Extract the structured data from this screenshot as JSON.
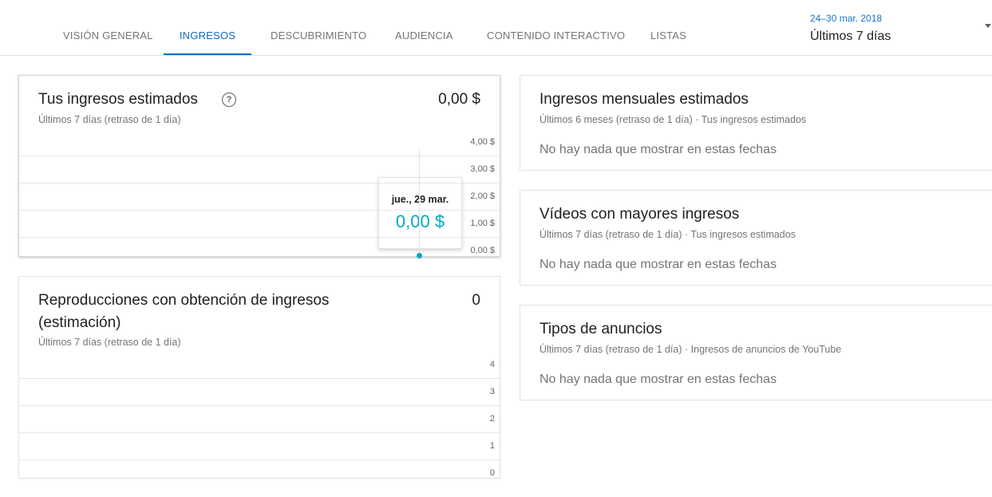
{
  "tabs": [
    {
      "label": "VISIÓN GENERAL",
      "active": false
    },
    {
      "label": "INGRESOS",
      "active": true
    },
    {
      "label": "DESCUBRIMIENTO",
      "active": false
    },
    {
      "label": "AUDIENCIA",
      "active": false
    },
    {
      "label": "CONTENIDO INTERACTIVO",
      "active": false
    },
    {
      "label": "LISTAS",
      "active": false
    }
  ],
  "date_selector": {
    "range": "24–30 mar. 2018",
    "period": "Últimos 7 días"
  },
  "colors": {
    "accent": "#0b6bbf",
    "series": "#00a8c6"
  },
  "revenue_card": {
    "title": "Tus ingresos estimados",
    "help_icon": "?",
    "subtitle": "Últimos 7 días (retraso de 1 día)",
    "total": "0,00 $",
    "tooltip": {
      "date": "jue., 29 mar.",
      "value": "0,00 $"
    }
  },
  "views_card": {
    "title_line1": "Reproducciones con obtención de ingresos",
    "title_line2": "(estimación)",
    "subtitle": "Últimos 7 días (retraso de 1 día)",
    "total": "0"
  },
  "monthly_card": {
    "title": "Ingresos mensuales estimados",
    "subtitle": "Últimos 6 meses (retraso de 1 día) · Tus ingresos estimados",
    "empty": "No hay nada que mostrar en estas fechas"
  },
  "top_videos_card": {
    "title": "Vídeos con mayores ingresos",
    "subtitle": "Últimos 7 días (retraso de 1 día) · Tus ingresos estimados",
    "empty": "No hay nada que mostrar en estas fechas"
  },
  "ad_types_card": {
    "title": "Tipos de anuncios",
    "subtitle": "Últimos 7 días (retraso de 1 día) · Ingresos de anuncios de YouTube",
    "empty": "No hay nada que mostrar en estas fechas"
  },
  "chart_data": [
    {
      "type": "line",
      "y_ticks": [
        "4,00 $",
        "3,00 $",
        "2,00 $",
        "1,00 $",
        "0,00 $"
      ],
      "ylim": [
        0,
        4
      ],
      "points": [
        {
          "x": "jue., 29 mar.",
          "y": 0
        }
      ],
      "grid": true
    },
    {
      "type": "line",
      "y_ticks": [
        "4",
        "3",
        "2",
        "1",
        "0"
      ],
      "ylim": [
        0,
        4
      ],
      "grid": true
    }
  ]
}
